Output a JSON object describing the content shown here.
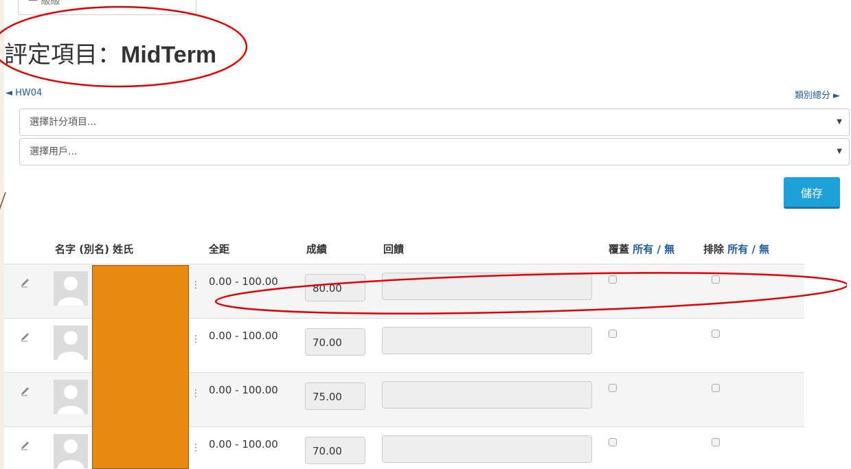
{
  "top_fragment": "一 級級",
  "title": {
    "prefix": "評定項目：",
    "name": "MidTerm"
  },
  "nav": {
    "prev": "◄ HW04",
    "next": "類別總分 ►"
  },
  "selects": [
    {
      "placeholder": "選擇計分項目...",
      "caret": "▼"
    },
    {
      "placeholder": "選擇用戶...",
      "caret": "▼"
    }
  ],
  "save_label": "儲存",
  "table": {
    "headers": {
      "name": "名字 (別名) 姓氏",
      "range": "全距",
      "grade": "成績",
      "feedback": "回饋",
      "override": "覆蓋",
      "override_links": "所有 / 無",
      "exclude": "排除",
      "exclude_links": "所有 / 無"
    },
    "rows": [
      {
        "range": "0.00 - 100.00",
        "grade": "80.00"
      },
      {
        "range": "0.00 - 100.00",
        "grade": "70.00"
      },
      {
        "range": "0.00 - 100.00",
        "grade": "75.00"
      },
      {
        "range": "0.00 - 100.00",
        "grade": "70.00"
      }
    ]
  },
  "colors": {
    "annotation": "#e00000",
    "save": "#1da1d8",
    "redaction": "#e88a12"
  }
}
